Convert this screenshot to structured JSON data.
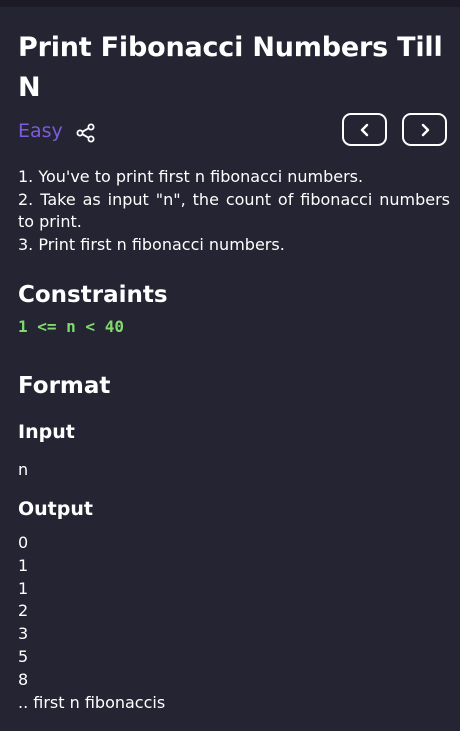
{
  "problem": {
    "title": "Print Fibonacci Numbers Till N",
    "difficulty": "Easy",
    "colors": {
      "background": "#252432",
      "difficulty": "#7c5cdc",
      "constraint": "#7fdb6a"
    }
  },
  "description": {
    "lines": [
      "1. You've to print first n fibonacci numbers.",
      "2. Take as input \"n\", the count of fibonacci numbers to print.",
      "3. Print first n fibonacci numbers."
    ]
  },
  "constraints": {
    "heading": "Constraints",
    "value": "1 <= n < 40"
  },
  "format": {
    "heading": "Format",
    "input_heading": "Input",
    "input_value": "n",
    "output_heading": "Output",
    "output_lines": [
      "0",
      "1",
      "1",
      "2",
      "3",
      "5",
      "8",
      ".. first n fibonaccis"
    ]
  },
  "icons": {
    "share": "share-icon",
    "prev": "chevron-left-icon",
    "next": "chevron-right-icon"
  }
}
